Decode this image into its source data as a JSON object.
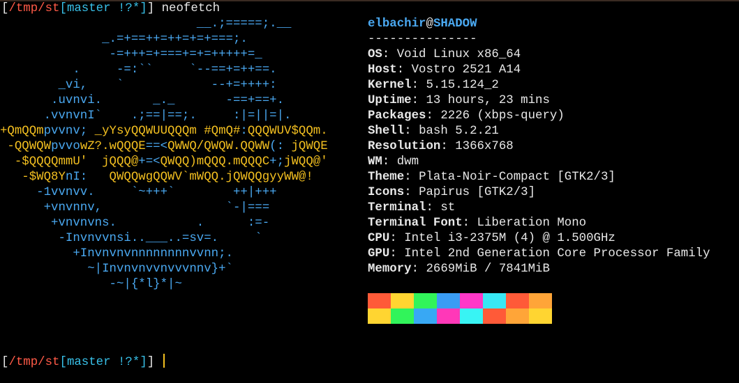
{
  "prompt": {
    "open": "[",
    "path": "/tmp/st",
    "branch_open": "[",
    "branch": "master !?*",
    "branch_close": "]",
    "close": "]",
    "command": "neofetch"
  },
  "ascii_art": [
    {
      "segments": [
        {
          "text": "                           __.;=====;.__",
          "color": "blue"
        }
      ]
    },
    {
      "segments": [
        {
          "text": "              _.=+==++=++=+=+===;.",
          "color": "blue"
        }
      ]
    },
    {
      "segments": [
        {
          "text": "               -=+++=+===+=+=+++++=_",
          "color": "blue"
        }
      ]
    },
    {
      "segments": [
        {
          "text": "          .     -=:``     `--==+=++==.",
          "color": "blue"
        }
      ]
    },
    {
      "segments": [
        {
          "text": "        _vi,    `            --+=++++:",
          "color": "blue"
        }
      ]
    },
    {
      "segments": [
        {
          "text": "       .uvnvi.       _._       -==+==+.",
          "color": "blue"
        }
      ]
    },
    {
      "segments": [
        {
          "text": "      .vvnvnI`    .;==|==;.     :|=||=|.",
          "color": "blue"
        }
      ]
    },
    {
      "segments": [
        {
          "text": "+QmQQm",
          "color": "yellow"
        },
        {
          "text": "pvvnv;",
          "color": "blue"
        },
        {
          "text": " _yYsyQQWUUQQQm #QmQ#",
          "color": "yellow"
        },
        {
          "text": ":",
          "color": "blue"
        },
        {
          "text": "QQQWUV$QQm.",
          "color": "yellow"
        }
      ]
    },
    {
      "segments": [
        {
          "text": " -QQWQW",
          "color": "yellow"
        },
        {
          "text": "pvvo",
          "color": "blue"
        },
        {
          "text": "wZ?.wQQQE",
          "color": "yellow"
        },
        {
          "text": "==<",
          "color": "blue"
        },
        {
          "text": "QWWQ/QWQW.QQWW",
          "color": "yellow"
        },
        {
          "text": "(: ",
          "color": "blue"
        },
        {
          "text": "jQWQE",
          "color": "yellow"
        }
      ]
    },
    {
      "segments": [
        {
          "text": "  -$QQQQmmU'  jQQQ@",
          "color": "yellow"
        },
        {
          "text": "+=<",
          "color": "blue"
        },
        {
          "text": "QWQQ)mQQQ.mQQQC",
          "color": "yellow"
        },
        {
          "text": "+;",
          "color": "blue"
        },
        {
          "text": "jWQQ@'",
          "color": "yellow"
        }
      ]
    },
    {
      "segments": [
        {
          "text": "   -$WQ8Y",
          "color": "yellow"
        },
        {
          "text": "nI:",
          "color": "blue"
        },
        {
          "text": "   QWQQwgQQWV`mWQQ.jQWQQgyyWW@!",
          "color": "yellow"
        }
      ]
    },
    {
      "segments": [
        {
          "text": "     -1vvnvv.     `~+++`        ++|+++",
          "color": "blue"
        }
      ]
    },
    {
      "segments": [
        {
          "text": "      +vnvnnv,                 `-|===",
          "color": "blue"
        }
      ]
    },
    {
      "segments": [
        {
          "text": "       +vnvnvns.           .      :=-",
          "color": "blue"
        }
      ]
    },
    {
      "segments": [
        {
          "text": "        -Invnvvnsi..___..=sv=.     `",
          "color": "blue"
        }
      ]
    },
    {
      "segments": [
        {
          "text": "          +Invnvnvnnnnnnnnvvnn;.",
          "color": "blue"
        }
      ]
    },
    {
      "segments": [
        {
          "text": "            ~|Invnvnvvnvvvnnv}+`",
          "color": "blue"
        }
      ]
    },
    {
      "segments": [
        {
          "text": "               -~|{*l}*|~",
          "color": "blue"
        }
      ]
    }
  ],
  "info": {
    "user": "elbachir",
    "at": "@",
    "host": "SHADOW",
    "separator": "---------------",
    "entries": [
      {
        "key": "OS",
        "value": "Void Linux x86_64"
      },
      {
        "key": "Host",
        "value": "Vostro 2521 A14"
      },
      {
        "key": "Kernel",
        "value": "5.15.124_2"
      },
      {
        "key": "Uptime",
        "value": "13 hours, 23 mins"
      },
      {
        "key": "Packages",
        "value": "2226 (xbps-query)"
      },
      {
        "key": "Shell",
        "value": "bash 5.2.21"
      },
      {
        "key": "Resolution",
        "value": "1366x768"
      },
      {
        "key": "WM",
        "value": "dwm"
      },
      {
        "key": "Theme",
        "value": "Plata-Noir-Compact [GTK2/3]"
      },
      {
        "key": "Icons",
        "value": "Papirus [GTK2/3]"
      },
      {
        "key": "Terminal",
        "value": "st"
      },
      {
        "key": "Terminal Font",
        "value": "Liberation Mono"
      },
      {
        "key": "CPU",
        "value": "Intel i3-2375M (4) @ 1.500GHz"
      },
      {
        "key": "GPU",
        "value": "Intel 2nd Generation Core Processor Family"
      },
      {
        "key": "Memory",
        "value": "2669MiB / 7841MiB"
      }
    ]
  },
  "colors": {
    "row1": [
      "#ff5a38",
      "#ffd531",
      "#31f45a",
      "#3a9cf4",
      "#ff38c8",
      "#38e8f4",
      "#ff5a38",
      "#ffa538"
    ],
    "row2": [
      "#ffd531",
      "#31f45a",
      "#38a8f4",
      "#ff38b8",
      "#38f4f4",
      "#ff5a38",
      "#ffa538",
      "#ffd531"
    ]
  }
}
